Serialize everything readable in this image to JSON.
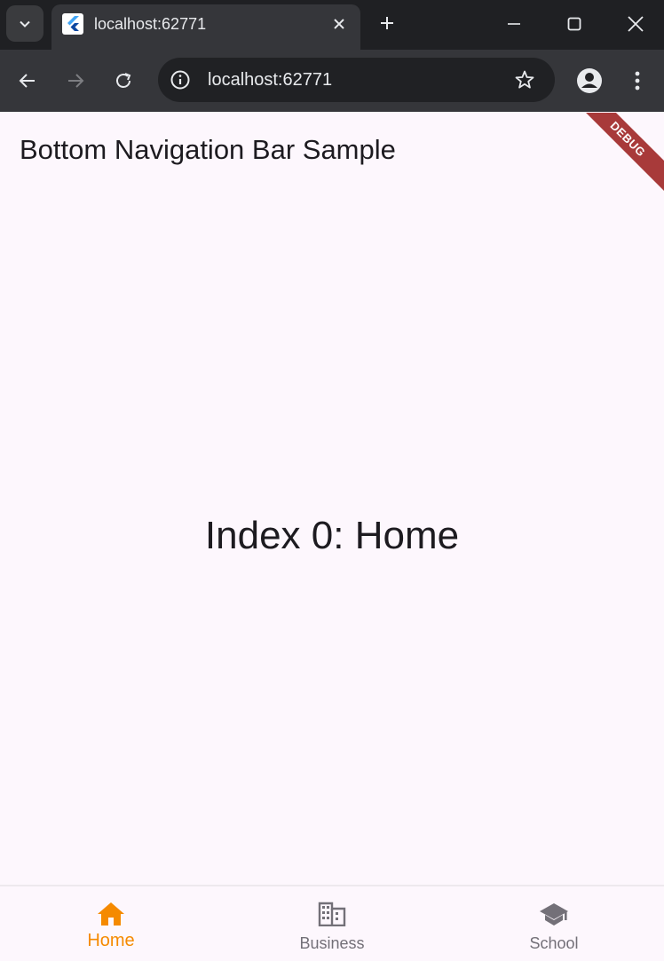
{
  "browser": {
    "tab_title": "localhost:62771",
    "url": "localhost:62771"
  },
  "app": {
    "title": "Bottom Navigation Bar Sample",
    "content": "Index 0: Home",
    "debug_banner": "DEBUG",
    "accent_color": "#f58a00"
  },
  "bottom_nav": {
    "items": [
      {
        "label": "Home",
        "icon": "home-icon",
        "selected": true
      },
      {
        "label": "Business",
        "icon": "business-icon",
        "selected": false
      },
      {
        "label": "School",
        "icon": "school-icon",
        "selected": false
      }
    ]
  }
}
